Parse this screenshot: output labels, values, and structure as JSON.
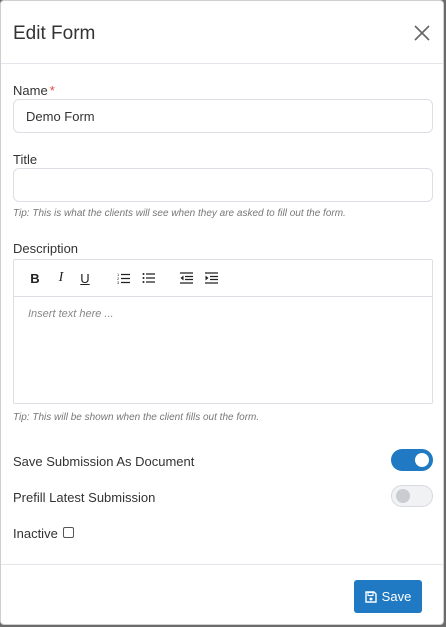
{
  "modal": {
    "title": "Edit Form"
  },
  "fields": {
    "name": {
      "label": "Name",
      "required_mark": "*",
      "value": "Demo Form"
    },
    "title": {
      "label": "Title",
      "value": "",
      "tip": "Tip: This is what the clients will see when they are asked to fill out the form."
    },
    "description": {
      "label": "Description",
      "placeholder": "Insert text here ...",
      "tip": "Tip: This will be shown when the client fills out the form.",
      "toolbar": [
        "bold",
        "italic",
        "underline",
        "ordered-list",
        "unordered-list",
        "outdent",
        "indent"
      ]
    }
  },
  "toggles": {
    "save_submission": {
      "label": "Save Submission As Document",
      "on": true
    },
    "prefill_latest": {
      "label": "Prefill Latest Submission",
      "on": false
    }
  },
  "inactive": {
    "label": "Inactive",
    "checked": false
  },
  "footer": {
    "save_label": "Save"
  },
  "colors": {
    "primary": "#1f79c3",
    "required": "#e0453c"
  }
}
